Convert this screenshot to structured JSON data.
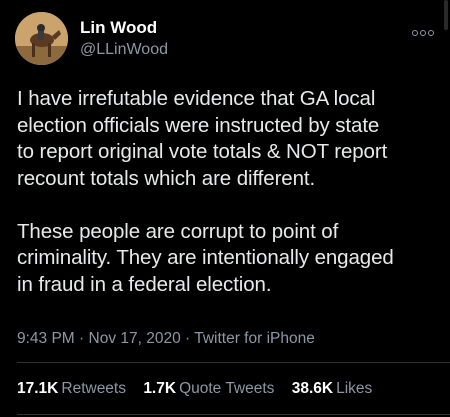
{
  "author": {
    "display_name": "Lin Wood",
    "handle": "@LLinWood"
  },
  "tweet": {
    "paragraphs": [
      [
        "I have irrefutable evidence that GA local",
        "election officials were instructed by state",
        "to report original vote totals & NOT report",
        "recount totals which are different."
      ],
      [
        "These people are corrupt to point of",
        "criminality. They are intentionally engaged",
        "in fraud in a federal election."
      ]
    ],
    "time": "9:43 PM",
    "date": "Nov 17, 2020",
    "separator": " · ",
    "source": "Twitter for iPhone"
  },
  "stats": {
    "retweets_count": "17.1K",
    "retweets_label": "Retweets",
    "quote_tweets_count": "1.7K",
    "quote_tweets_label": "Quote Tweets",
    "likes_count": "38.6K",
    "likes_label": "Likes"
  },
  "icons": {
    "more": "more-options-icon"
  },
  "colors": {
    "background": "#000000",
    "text": "#e7e9ea",
    "secondary": "#8b98a5",
    "divider": "#2f3336"
  }
}
